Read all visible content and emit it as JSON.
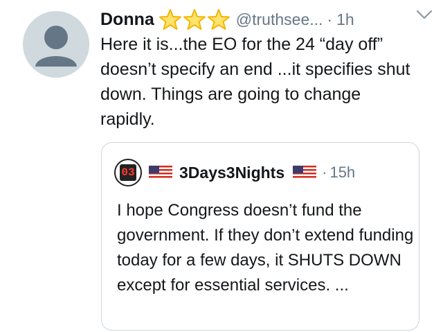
{
  "tweet": {
    "author_name": "Donna",
    "handle": "@truthsee...",
    "separator": "·",
    "time": "1h",
    "text": "Here it is...the EO for the 24 “day off” doesn’t specify an end ...it specifies shut down. Things are going to change rapidly.",
    "icons": [
      "star-icon",
      "star-icon",
      "star-icon",
      "chevron-down-icon"
    ]
  },
  "quote": {
    "author_name": "3Days3Nights",
    "avatar_text": "03",
    "separator": "·",
    "time": "15h",
    "text": "I hope Congress doesn’t fund the government. If they don’t extend funding today for a few days, it SHUTS DOWN except for essential services. ...",
    "icons": [
      "us-flag-icon",
      "us-flag-icon"
    ]
  },
  "colors": {
    "secondary_text": "#657786",
    "border": "#ccd6dd",
    "avatar_bg": "#cfd9de",
    "avatar_fg": "#657786",
    "star_fill": "#ffe36e",
    "star_stroke": "#f5b400"
  }
}
